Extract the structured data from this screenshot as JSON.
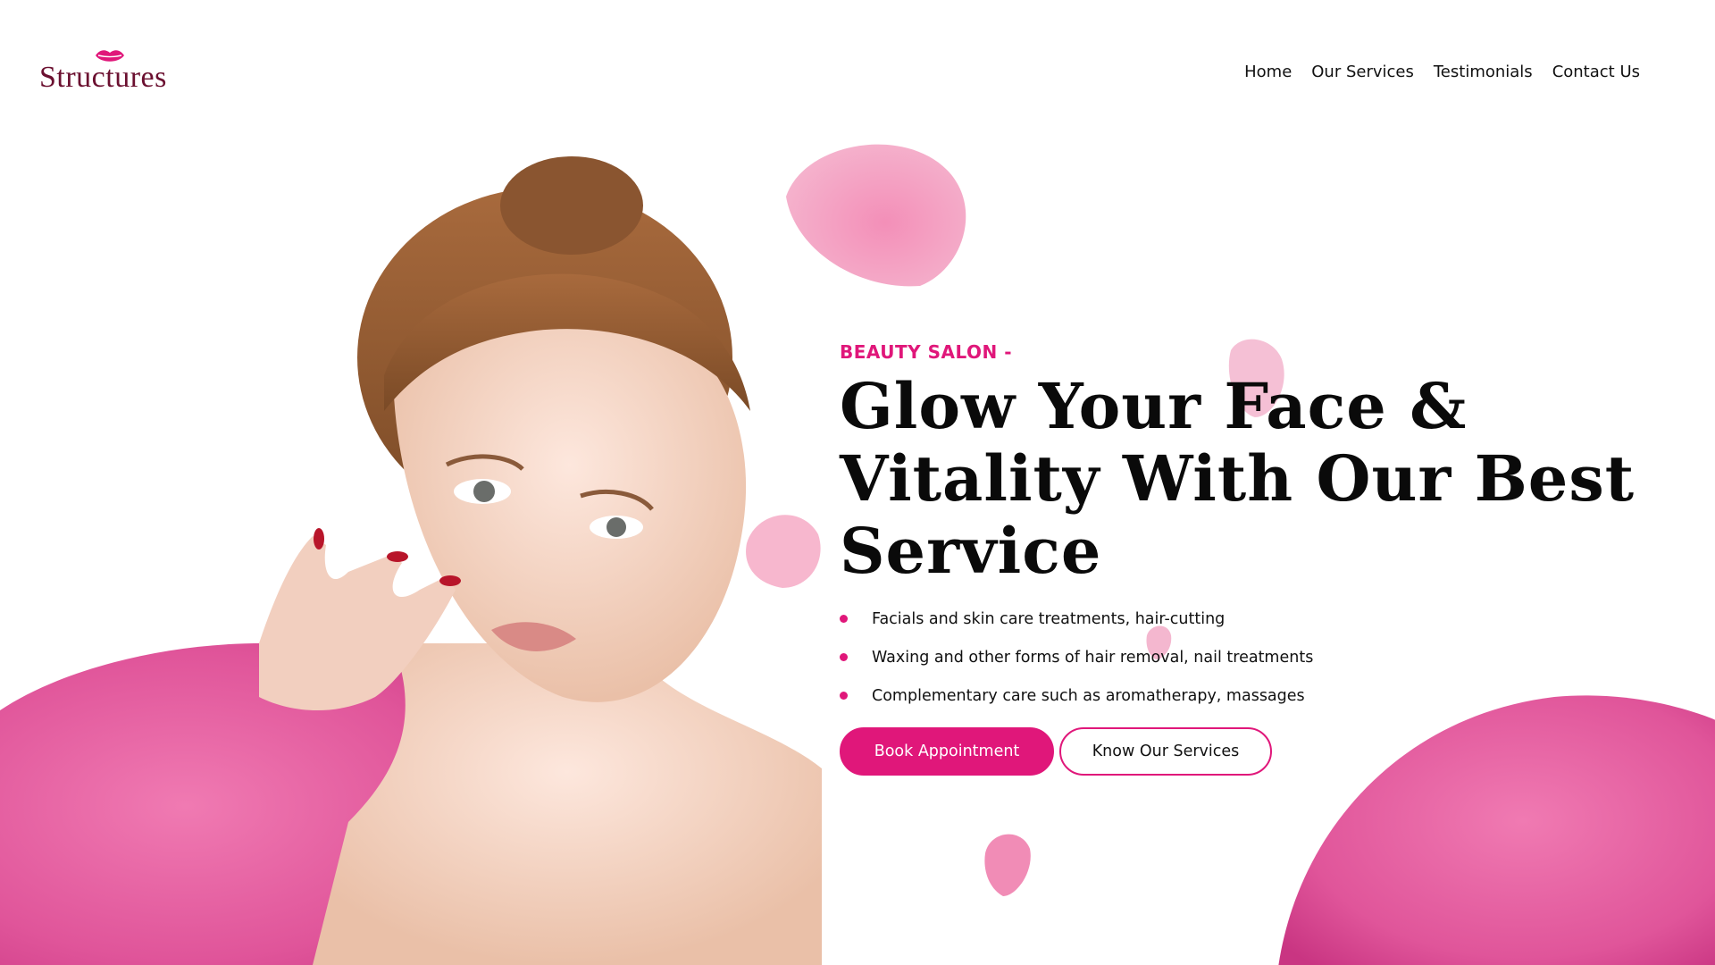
{
  "brand": {
    "name": "Structures",
    "logo_icon": "lips-icon",
    "accent": "#e0177a",
    "logo_color": "#6b1030"
  },
  "nav": {
    "items": [
      {
        "label": "Home"
      },
      {
        "label": "Our Services"
      },
      {
        "label": "Testimonials"
      },
      {
        "label": "Contact Us"
      }
    ]
  },
  "hero": {
    "eyebrow": "BEAUTY SALON -",
    "headline_line1": "Glow Your Face &",
    "headline_line2": "Vitality With Our Best",
    "headline_line3": "Service",
    "features": [
      "Facials and skin care treatments, hair-cutting",
      "Waxing and other forms of hair removal, nail treatments",
      "Complementary care such as aromatherapy, massages"
    ],
    "primary_button": "Book Appointment",
    "secondary_button": "Know Our Services"
  },
  "colors": {
    "petal": "#e8559a",
    "petal_light": "#f6a9c6",
    "text": "#0a0a0a"
  }
}
